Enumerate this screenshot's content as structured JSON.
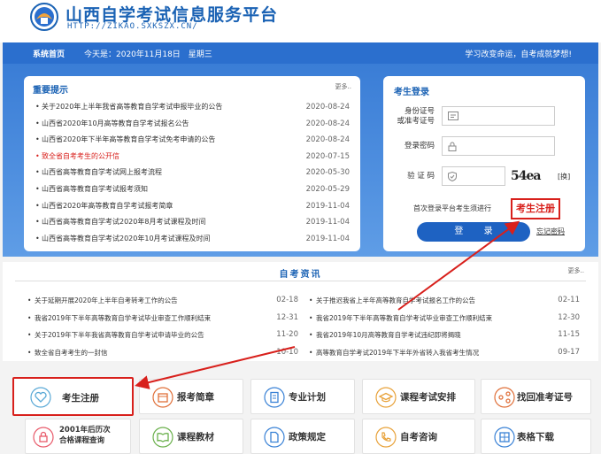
{
  "header": {
    "title": "山西自学考试信息服务平台",
    "url": "HTTP://ZIKAO.SXKSZX.CN/"
  },
  "nav": {
    "home": "系统首页",
    "date": "今天是：2020年11月18日　星期三",
    "slogan": "学习改变命运，自考成就梦想!"
  },
  "notices": {
    "title": "重要提示",
    "more": "更多..",
    "items": [
      {
        "text": "关于2020年上半年我省高等教育自学考试申报毕业的公告",
        "date": "2020-08-24",
        "highlight": false
      },
      {
        "text": "山西省2020年10月高等教育自学考试报名公告",
        "date": "2020-08-24",
        "highlight": false
      },
      {
        "text": "山西省2020年下半年高等教育自学考试免考申请的公告",
        "date": "2020-08-24",
        "highlight": false
      },
      {
        "text": "致全省自考考生的公开信",
        "date": "2020-07-15",
        "highlight": true
      },
      {
        "text": "山西省高等教育自学考试网上报考流程",
        "date": "2020-05-30",
        "highlight": false
      },
      {
        "text": "山西省高等教育自学考试报考须知",
        "date": "2020-05-29",
        "highlight": false
      },
      {
        "text": "山西省2020年高等教育自学考试报考简章",
        "date": "2019-11-04",
        "highlight": false
      },
      {
        "text": "山西省高等教育自学考试2020年8月考试课程及时间",
        "date": "2019-11-04",
        "highlight": false
      },
      {
        "text": "山西省高等教育自学考试2020年10月考试课程及时间",
        "date": "2019-11-04",
        "highlight": false
      }
    ]
  },
  "login": {
    "title": "考生登录",
    "id_label": "身份证号\n或准考证号",
    "password_label": "登录密码",
    "captcha_label": "验 证 码",
    "captcha_text": "54ea",
    "captcha_change": "[换]",
    "first_login_text": "首次登录平台考生须进行",
    "register_link": "考生注册",
    "login_button": "登 录",
    "forgot_link": "忘记密码"
  },
  "news": {
    "title": "自考资讯",
    "more": "更多..",
    "left": [
      {
        "text": "关于延期开展2020年上半年自考转考工作的公告",
        "date": "02-18"
      },
      {
        "text": "我省2019年下半年高等教育自学考试毕业审查工作顺利结束",
        "date": "12-31"
      },
      {
        "text": "关于2019年下半年我省高等教育自学考试申请毕业的公告",
        "date": "11-20"
      },
      {
        "text": "致全省自考考生的一封信",
        "date": "10-10"
      }
    ],
    "right": [
      {
        "text": "关于推迟我省上半年高等教育自学考试报名工作的公告",
        "date": "02-11"
      },
      {
        "text": "我省2019年下半年高等教育自学考试毕业审查工作顺利结束",
        "date": "12-30"
      },
      {
        "text": "我省2019年10月高等教育自学考试违纪即将揭晓",
        "date": "11-15"
      },
      {
        "text": "高等教育自学考试2019年下半年外省转入我省考生情况",
        "date": "09-17"
      }
    ]
  },
  "quick": {
    "register": "考生注册",
    "guide": "报考简章",
    "major_plan": "专业计划",
    "exam_schedule": "课程考试安排",
    "retrieve_ticket": "找回准考证号",
    "history_courses": "2001年后历次\n合格课程查询",
    "textbooks": "课程教材",
    "policy": "政策规定",
    "consult": "自考咨询",
    "downloads": "表格下载"
  },
  "colors": {
    "brand": "#1a62b4",
    "nav": "#2b6fce",
    "alert": "#d8201c"
  }
}
